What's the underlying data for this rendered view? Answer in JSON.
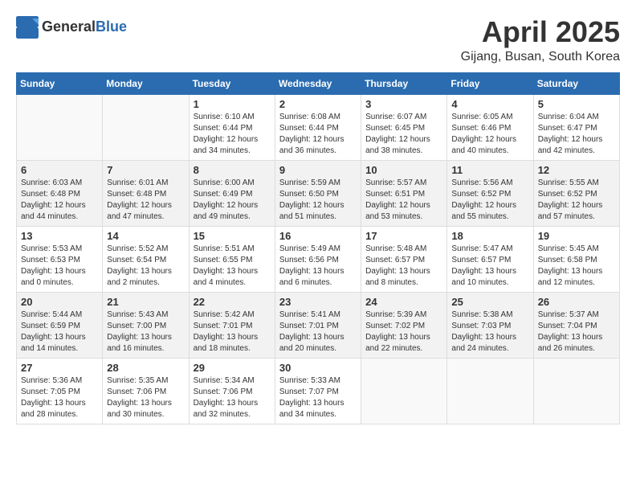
{
  "header": {
    "logo_general": "General",
    "logo_blue": "Blue",
    "month_title": "April 2025",
    "location": "Gijang, Busan, South Korea"
  },
  "days_of_week": [
    "Sunday",
    "Monday",
    "Tuesday",
    "Wednesday",
    "Thursday",
    "Friday",
    "Saturday"
  ],
  "weeks": [
    {
      "shaded": false,
      "days": [
        {
          "empty": true
        },
        {
          "empty": true
        },
        {
          "num": "1",
          "info": "Sunrise: 6:10 AM\nSunset: 6:44 PM\nDaylight: 12 hours\nand 34 minutes."
        },
        {
          "num": "2",
          "info": "Sunrise: 6:08 AM\nSunset: 6:44 PM\nDaylight: 12 hours\nand 36 minutes."
        },
        {
          "num": "3",
          "info": "Sunrise: 6:07 AM\nSunset: 6:45 PM\nDaylight: 12 hours\nand 38 minutes."
        },
        {
          "num": "4",
          "info": "Sunrise: 6:05 AM\nSunset: 6:46 PM\nDaylight: 12 hours\nand 40 minutes."
        },
        {
          "num": "5",
          "info": "Sunrise: 6:04 AM\nSunset: 6:47 PM\nDaylight: 12 hours\nand 42 minutes."
        }
      ]
    },
    {
      "shaded": true,
      "days": [
        {
          "num": "6",
          "info": "Sunrise: 6:03 AM\nSunset: 6:48 PM\nDaylight: 12 hours\nand 44 minutes."
        },
        {
          "num": "7",
          "info": "Sunrise: 6:01 AM\nSunset: 6:48 PM\nDaylight: 12 hours\nand 47 minutes."
        },
        {
          "num": "8",
          "info": "Sunrise: 6:00 AM\nSunset: 6:49 PM\nDaylight: 12 hours\nand 49 minutes."
        },
        {
          "num": "9",
          "info": "Sunrise: 5:59 AM\nSunset: 6:50 PM\nDaylight: 12 hours\nand 51 minutes."
        },
        {
          "num": "10",
          "info": "Sunrise: 5:57 AM\nSunset: 6:51 PM\nDaylight: 12 hours\nand 53 minutes."
        },
        {
          "num": "11",
          "info": "Sunrise: 5:56 AM\nSunset: 6:52 PM\nDaylight: 12 hours\nand 55 minutes."
        },
        {
          "num": "12",
          "info": "Sunrise: 5:55 AM\nSunset: 6:52 PM\nDaylight: 12 hours\nand 57 minutes."
        }
      ]
    },
    {
      "shaded": false,
      "days": [
        {
          "num": "13",
          "info": "Sunrise: 5:53 AM\nSunset: 6:53 PM\nDaylight: 13 hours\nand 0 minutes."
        },
        {
          "num": "14",
          "info": "Sunrise: 5:52 AM\nSunset: 6:54 PM\nDaylight: 13 hours\nand 2 minutes."
        },
        {
          "num": "15",
          "info": "Sunrise: 5:51 AM\nSunset: 6:55 PM\nDaylight: 13 hours\nand 4 minutes."
        },
        {
          "num": "16",
          "info": "Sunrise: 5:49 AM\nSunset: 6:56 PM\nDaylight: 13 hours\nand 6 minutes."
        },
        {
          "num": "17",
          "info": "Sunrise: 5:48 AM\nSunset: 6:57 PM\nDaylight: 13 hours\nand 8 minutes."
        },
        {
          "num": "18",
          "info": "Sunrise: 5:47 AM\nSunset: 6:57 PM\nDaylight: 13 hours\nand 10 minutes."
        },
        {
          "num": "19",
          "info": "Sunrise: 5:45 AM\nSunset: 6:58 PM\nDaylight: 13 hours\nand 12 minutes."
        }
      ]
    },
    {
      "shaded": true,
      "days": [
        {
          "num": "20",
          "info": "Sunrise: 5:44 AM\nSunset: 6:59 PM\nDaylight: 13 hours\nand 14 minutes."
        },
        {
          "num": "21",
          "info": "Sunrise: 5:43 AM\nSunset: 7:00 PM\nDaylight: 13 hours\nand 16 minutes."
        },
        {
          "num": "22",
          "info": "Sunrise: 5:42 AM\nSunset: 7:01 PM\nDaylight: 13 hours\nand 18 minutes."
        },
        {
          "num": "23",
          "info": "Sunrise: 5:41 AM\nSunset: 7:01 PM\nDaylight: 13 hours\nand 20 minutes."
        },
        {
          "num": "24",
          "info": "Sunrise: 5:39 AM\nSunset: 7:02 PM\nDaylight: 13 hours\nand 22 minutes."
        },
        {
          "num": "25",
          "info": "Sunrise: 5:38 AM\nSunset: 7:03 PM\nDaylight: 13 hours\nand 24 minutes."
        },
        {
          "num": "26",
          "info": "Sunrise: 5:37 AM\nSunset: 7:04 PM\nDaylight: 13 hours\nand 26 minutes."
        }
      ]
    },
    {
      "shaded": false,
      "days": [
        {
          "num": "27",
          "info": "Sunrise: 5:36 AM\nSunset: 7:05 PM\nDaylight: 13 hours\nand 28 minutes."
        },
        {
          "num": "28",
          "info": "Sunrise: 5:35 AM\nSunset: 7:06 PM\nDaylight: 13 hours\nand 30 minutes."
        },
        {
          "num": "29",
          "info": "Sunrise: 5:34 AM\nSunset: 7:06 PM\nDaylight: 13 hours\nand 32 minutes."
        },
        {
          "num": "30",
          "info": "Sunrise: 5:33 AM\nSunset: 7:07 PM\nDaylight: 13 hours\nand 34 minutes."
        },
        {
          "empty": true
        },
        {
          "empty": true
        },
        {
          "empty": true
        }
      ]
    }
  ]
}
